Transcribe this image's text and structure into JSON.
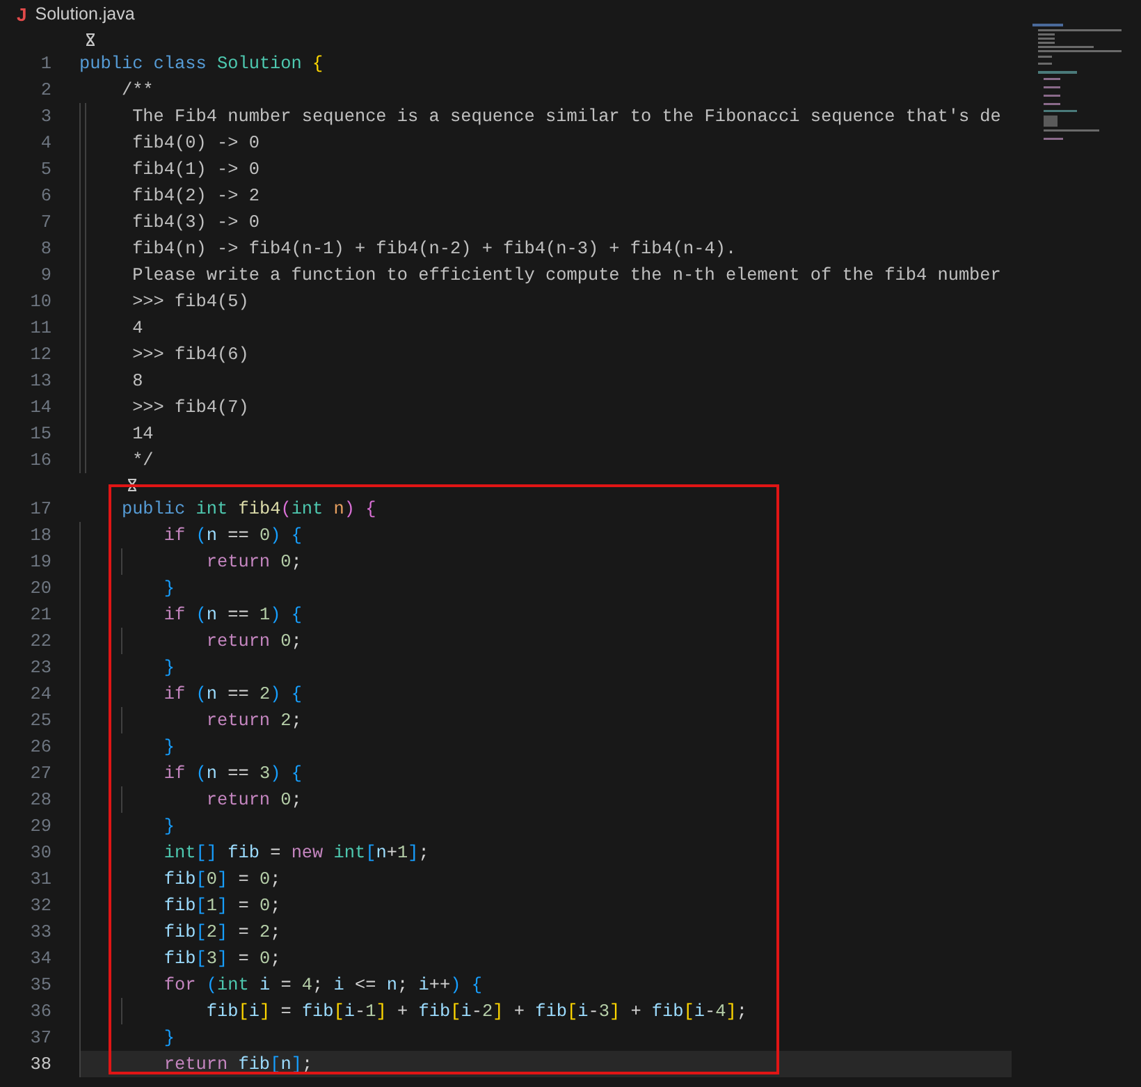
{
  "tab": {
    "icon_letter": "J",
    "title": "Solution.java"
  },
  "sections": [
    {
      "boxed": false,
      "lines": [
        {
          "number": "1",
          "codelens": true,
          "current": false,
          "tokens": [
            {
              "kind": "kw",
              "text": "public"
            },
            {
              "kind": "kw",
              "text": " class"
            },
            {
              "kind": "type",
              "text": " Solution"
            },
            {
              "kind": "b1",
              "text": " {"
            }
          ]
        },
        {
          "number": "2",
          "codelens": false,
          "current": false,
          "tokens": [
            {
              "kind": "cm",
              "text": "    /**"
            }
          ]
        },
        {
          "number": "3",
          "codelens": false,
          "current": false,
          "tokens": [
            {
              "kind": "cm",
              "text": "     The Fib4 number sequence is a sequence similar to the Fibonacci sequence that's de"
            }
          ]
        },
        {
          "number": "4",
          "codelens": false,
          "current": false,
          "tokens": [
            {
              "kind": "cm",
              "text": "     fib4(0) -> 0"
            }
          ]
        },
        {
          "number": "5",
          "codelens": false,
          "current": false,
          "tokens": [
            {
              "kind": "cm",
              "text": "     fib4(1) -> 0"
            }
          ]
        },
        {
          "number": "6",
          "codelens": false,
          "current": false,
          "tokens": [
            {
              "kind": "cm",
              "text": "     fib4(2) -> 2"
            }
          ]
        },
        {
          "number": "7",
          "codelens": false,
          "current": false,
          "tokens": [
            {
              "kind": "cm",
              "text": "     fib4(3) -> 0"
            }
          ]
        },
        {
          "number": "8",
          "codelens": false,
          "current": false,
          "tokens": [
            {
              "kind": "cm",
              "text": "     fib4(n) -> fib4(n-1) + fib4(n-2) + fib4(n-3) + fib4(n-4)."
            }
          ]
        },
        {
          "number": "9",
          "codelens": false,
          "current": false,
          "tokens": [
            {
              "kind": "cm",
              "text": "     Please write a function to efficiently compute the n-th element of the fib4 number"
            }
          ]
        },
        {
          "number": "10",
          "codelens": false,
          "current": false,
          "tokens": [
            {
              "kind": "cm",
              "text": "     >>> fib4(5)"
            }
          ]
        },
        {
          "number": "11",
          "codelens": false,
          "current": false,
          "tokens": [
            {
              "kind": "cm",
              "text": "     4"
            }
          ]
        },
        {
          "number": "12",
          "codelens": false,
          "current": false,
          "tokens": [
            {
              "kind": "cm",
              "text": "     >>> fib4(6)"
            }
          ]
        },
        {
          "number": "13",
          "codelens": false,
          "current": false,
          "tokens": [
            {
              "kind": "cm",
              "text": "     8"
            }
          ]
        },
        {
          "number": "14",
          "codelens": false,
          "current": false,
          "tokens": [
            {
              "kind": "cm",
              "text": "     >>> fib4(7)"
            }
          ]
        },
        {
          "number": "15",
          "codelens": false,
          "current": false,
          "tokens": [
            {
              "kind": "cm",
              "text": "     14"
            }
          ]
        },
        {
          "number": "16",
          "codelens": false,
          "current": false,
          "tokens": [
            {
              "kind": "cm",
              "text": "     */"
            }
          ]
        }
      ]
    },
    {
      "boxed": true,
      "lines": [
        {
          "number": "17",
          "codelens": true,
          "current": false,
          "tokens": [
            {
              "kind": "kw",
              "text": "    public"
            },
            {
              "kind": "type",
              "text": " int"
            },
            {
              "kind": "fn",
              "text": " fib4"
            },
            {
              "kind": "b2",
              "text": "("
            },
            {
              "kind": "type",
              "text": "int"
            },
            {
              "kind": "param",
              "text": " n"
            },
            {
              "kind": "b2",
              "text": ")"
            },
            {
              "kind": "b2",
              "text": " {"
            }
          ]
        },
        {
          "number": "18",
          "codelens": false,
          "current": false,
          "tokens": [
            {
              "kind": "ctl",
              "text": "        if"
            },
            {
              "kind": "b3",
              "text": " ("
            },
            {
              "kind": "var",
              "text": "n"
            },
            {
              "kind": "op",
              "text": " =="
            },
            {
              "kind": "num",
              "text": " 0"
            },
            {
              "kind": "b3",
              "text": ")"
            },
            {
              "kind": "b3",
              "text": " {"
            }
          ]
        },
        {
          "number": "19",
          "codelens": false,
          "current": false,
          "tokens": [
            {
              "kind": "ctl",
              "text": "            return"
            },
            {
              "kind": "num",
              "text": " 0"
            },
            {
              "kind": "op",
              "text": ";"
            }
          ]
        },
        {
          "number": "20",
          "codelens": false,
          "current": false,
          "tokens": [
            {
              "kind": "b3",
              "text": "        }"
            }
          ]
        },
        {
          "number": "21",
          "codelens": false,
          "current": false,
          "tokens": [
            {
              "kind": "ctl",
              "text": "        if"
            },
            {
              "kind": "b3",
              "text": " ("
            },
            {
              "kind": "var",
              "text": "n"
            },
            {
              "kind": "op",
              "text": " =="
            },
            {
              "kind": "num",
              "text": " 1"
            },
            {
              "kind": "b3",
              "text": ")"
            },
            {
              "kind": "b3",
              "text": " {"
            }
          ]
        },
        {
          "number": "22",
          "codelens": false,
          "current": false,
          "tokens": [
            {
              "kind": "ctl",
              "text": "            return"
            },
            {
              "kind": "num",
              "text": " 0"
            },
            {
              "kind": "op",
              "text": ";"
            }
          ]
        },
        {
          "number": "23",
          "codelens": false,
          "current": false,
          "tokens": [
            {
              "kind": "b3",
              "text": "        }"
            }
          ]
        },
        {
          "number": "24",
          "codelens": false,
          "current": false,
          "tokens": [
            {
              "kind": "ctl",
              "text": "        if"
            },
            {
              "kind": "b3",
              "text": " ("
            },
            {
              "kind": "var",
              "text": "n"
            },
            {
              "kind": "op",
              "text": " =="
            },
            {
              "kind": "num",
              "text": " 2"
            },
            {
              "kind": "b3",
              "text": ")"
            },
            {
              "kind": "b3",
              "text": " {"
            }
          ]
        },
        {
          "number": "25",
          "codelens": false,
          "current": false,
          "tokens": [
            {
              "kind": "ctl",
              "text": "            return"
            },
            {
              "kind": "num",
              "text": " 2"
            },
            {
              "kind": "op",
              "text": ";"
            }
          ]
        },
        {
          "number": "26",
          "codelens": false,
          "current": false,
          "tokens": [
            {
              "kind": "b3",
              "text": "        }"
            }
          ]
        },
        {
          "number": "27",
          "codelens": false,
          "current": false,
          "tokens": [
            {
              "kind": "ctl",
              "text": "        if"
            },
            {
              "kind": "b3",
              "text": " ("
            },
            {
              "kind": "var",
              "text": "n"
            },
            {
              "kind": "op",
              "text": " =="
            },
            {
              "kind": "num",
              "text": " 3"
            },
            {
              "kind": "b3",
              "text": ")"
            },
            {
              "kind": "b3",
              "text": " {"
            }
          ]
        },
        {
          "number": "28",
          "codelens": false,
          "current": false,
          "tokens": [
            {
              "kind": "ctl",
              "text": "            return"
            },
            {
              "kind": "num",
              "text": " 0"
            },
            {
              "kind": "op",
              "text": ";"
            }
          ]
        },
        {
          "number": "29",
          "codelens": false,
          "current": false,
          "tokens": [
            {
              "kind": "b3",
              "text": "        }"
            }
          ]
        },
        {
          "number": "30",
          "codelens": false,
          "current": false,
          "tokens": [
            {
              "kind": "type",
              "text": "        int"
            },
            {
              "kind": "b3",
              "text": "[]"
            },
            {
              "kind": "var",
              "text": " fib"
            },
            {
              "kind": "op",
              "text": " ="
            },
            {
              "kind": "ctl",
              "text": " new"
            },
            {
              "kind": "type",
              "text": " int"
            },
            {
              "kind": "b3",
              "text": "["
            },
            {
              "kind": "var",
              "text": "n"
            },
            {
              "kind": "op",
              "text": "+"
            },
            {
              "kind": "num",
              "text": "1"
            },
            {
              "kind": "b3",
              "text": "]"
            },
            {
              "kind": "op",
              "text": ";"
            }
          ]
        },
        {
          "number": "31",
          "codelens": false,
          "current": false,
          "tokens": [
            {
              "kind": "var",
              "text": "        fib"
            },
            {
              "kind": "b3",
              "text": "["
            },
            {
              "kind": "num",
              "text": "0"
            },
            {
              "kind": "b3",
              "text": "]"
            },
            {
              "kind": "op",
              "text": " ="
            },
            {
              "kind": "num",
              "text": " 0"
            },
            {
              "kind": "op",
              "text": ";"
            }
          ]
        },
        {
          "number": "32",
          "codelens": false,
          "current": false,
          "tokens": [
            {
              "kind": "var",
              "text": "        fib"
            },
            {
              "kind": "b3",
              "text": "["
            },
            {
              "kind": "num",
              "text": "1"
            },
            {
              "kind": "b3",
              "text": "]"
            },
            {
              "kind": "op",
              "text": " ="
            },
            {
              "kind": "num",
              "text": " 0"
            },
            {
              "kind": "op",
              "text": ";"
            }
          ]
        },
        {
          "number": "33",
          "codelens": false,
          "current": false,
          "tokens": [
            {
              "kind": "var",
              "text": "        fib"
            },
            {
              "kind": "b3",
              "text": "["
            },
            {
              "kind": "num",
              "text": "2"
            },
            {
              "kind": "b3",
              "text": "]"
            },
            {
              "kind": "op",
              "text": " ="
            },
            {
              "kind": "num",
              "text": " 2"
            },
            {
              "kind": "op",
              "text": ";"
            }
          ]
        },
        {
          "number": "34",
          "codelens": false,
          "current": false,
          "tokens": [
            {
              "kind": "var",
              "text": "        fib"
            },
            {
              "kind": "b3",
              "text": "["
            },
            {
              "kind": "num",
              "text": "3"
            },
            {
              "kind": "b3",
              "text": "]"
            },
            {
              "kind": "op",
              "text": " ="
            },
            {
              "kind": "num",
              "text": " 0"
            },
            {
              "kind": "op",
              "text": ";"
            }
          ]
        },
        {
          "number": "35",
          "codelens": false,
          "current": false,
          "tokens": [
            {
              "kind": "ctl",
              "text": "        for"
            },
            {
              "kind": "b3",
              "text": " ("
            },
            {
              "kind": "type",
              "text": "int"
            },
            {
              "kind": "var",
              "text": " i"
            },
            {
              "kind": "op",
              "text": " ="
            },
            {
              "kind": "num",
              "text": " 4"
            },
            {
              "kind": "op",
              "text": ";"
            },
            {
              "kind": "var",
              "text": " i"
            },
            {
              "kind": "op",
              "text": " <="
            },
            {
              "kind": "var",
              "text": " n"
            },
            {
              "kind": "op",
              "text": ";"
            },
            {
              "kind": "var",
              "text": " i"
            },
            {
              "kind": "op",
              "text": "++"
            },
            {
              "kind": "b3",
              "text": ")"
            },
            {
              "kind": "b3",
              "text": " {"
            }
          ]
        },
        {
          "number": "36",
          "codelens": false,
          "current": false,
          "tokens": [
            {
              "kind": "var",
              "text": "            fib"
            },
            {
              "kind": "b1",
              "text": "["
            },
            {
              "kind": "var",
              "text": "i"
            },
            {
              "kind": "b1",
              "text": "]"
            },
            {
              "kind": "op",
              "text": " ="
            },
            {
              "kind": "var",
              "text": " fib"
            },
            {
              "kind": "b1",
              "text": "["
            },
            {
              "kind": "var",
              "text": "i"
            },
            {
              "kind": "op",
              "text": "-"
            },
            {
              "kind": "num",
              "text": "1"
            },
            {
              "kind": "b1",
              "text": "]"
            },
            {
              "kind": "op",
              "text": " +"
            },
            {
              "kind": "var",
              "text": " fib"
            },
            {
              "kind": "b1",
              "text": "["
            },
            {
              "kind": "var",
              "text": "i"
            },
            {
              "kind": "op",
              "text": "-"
            },
            {
              "kind": "num",
              "text": "2"
            },
            {
              "kind": "b1",
              "text": "]"
            },
            {
              "kind": "op",
              "text": " +"
            },
            {
              "kind": "var",
              "text": " fib"
            },
            {
              "kind": "b1",
              "text": "["
            },
            {
              "kind": "var",
              "text": "i"
            },
            {
              "kind": "op",
              "text": "-"
            },
            {
              "kind": "num",
              "text": "3"
            },
            {
              "kind": "b1",
              "text": "]"
            },
            {
              "kind": "op",
              "text": " +"
            },
            {
              "kind": "var",
              "text": " fib"
            },
            {
              "kind": "b1",
              "text": "["
            },
            {
              "kind": "var",
              "text": "i"
            },
            {
              "kind": "op",
              "text": "-"
            },
            {
              "kind": "num",
              "text": "4"
            },
            {
              "kind": "b1",
              "text": "]"
            },
            {
              "kind": "op",
              "text": ";"
            }
          ]
        },
        {
          "number": "37",
          "codelens": false,
          "current": false,
          "tokens": [
            {
              "kind": "b3",
              "text": "        }"
            }
          ]
        },
        {
          "number": "38",
          "codelens": false,
          "current": true,
          "tokens": [
            {
              "kind": "ctl",
              "text": "        return"
            },
            {
              "kind": "var",
              "text": " fib"
            },
            {
              "kind": "b3",
              "text": "["
            },
            {
              "kind": "var",
              "text": "n"
            },
            {
              "kind": "b3",
              "text": "]"
            },
            {
              "kind": "op",
              "text": ";"
            }
          ]
        }
      ]
    }
  ]
}
